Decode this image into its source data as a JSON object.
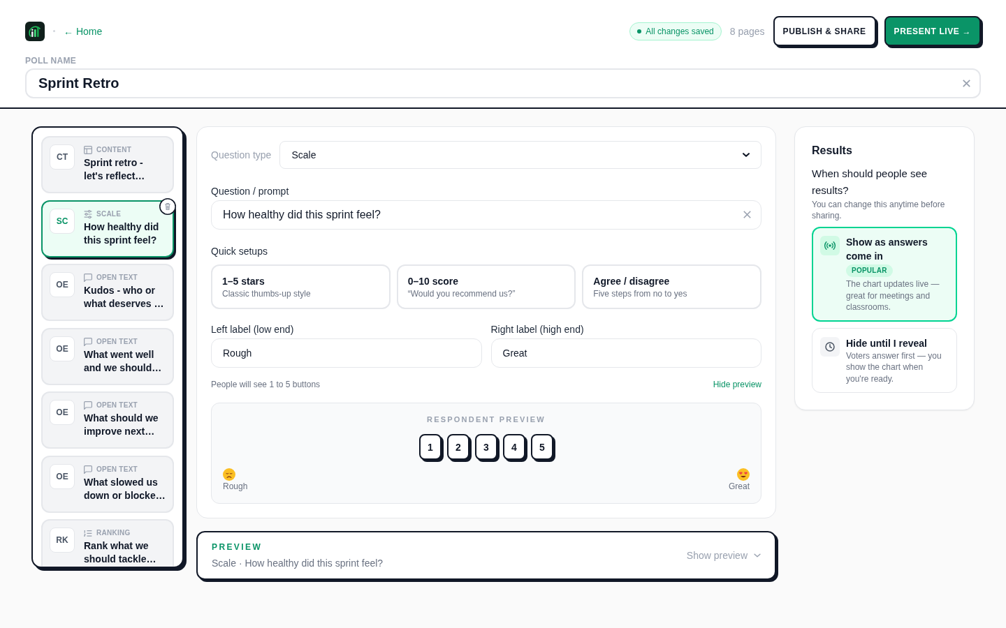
{
  "header": {
    "home_link": "← Home",
    "save_status": "All changes saved",
    "page_count": "8 pages",
    "actions": [
      {
        "label": "PUBLISH & SHARE",
        "kind": "secondary"
      },
      {
        "label": "PRESENT LIVE →",
        "kind": "primary"
      }
    ]
  },
  "poll_name": {
    "label": "POLL NAME",
    "value": "Sprint Retro"
  },
  "pages": [
    {
      "abbr": "CT",
      "kind": "content",
      "type_label": "CONTENT",
      "title": "Sprint retro - let's reflect…",
      "selected": false
    },
    {
      "abbr": "SC",
      "kind": "scale",
      "type_label": "SCALE",
      "title": "How healthy did this sprint feel?",
      "selected": true
    },
    {
      "abbr": "OE",
      "kind": "open_text",
      "type_label": "OPEN TEXT",
      "title": "Kudos - who or what deserves …",
      "selected": false
    },
    {
      "abbr": "OE",
      "kind": "open_text",
      "type_label": "OPEN TEXT",
      "title": "What went well and we should…",
      "selected": false
    },
    {
      "abbr": "OE",
      "kind": "open_text",
      "type_label": "OPEN TEXT",
      "title": "What should we improve next…",
      "selected": false
    },
    {
      "abbr": "OE",
      "kind": "open_text",
      "type_label": "OPEN TEXT",
      "title": "What slowed us down or blocke…",
      "selected": false
    },
    {
      "abbr": "RK",
      "kind": "ranking",
      "type_label": "RANKING",
      "title": "Rank what we should tackle…",
      "selected": false
    }
  ],
  "editor": {
    "question_type": {
      "label": "Question type",
      "value": "Scale"
    },
    "prompt": {
      "label": "Question / prompt",
      "value": "How healthy did this sprint feel?"
    },
    "quick_setups": {
      "label": "Quick setups",
      "options": [
        {
          "title": "1–5 stars",
          "subtitle": "Classic thumbs-up style"
        },
        {
          "title": "0–10 score",
          "subtitle": "“Would you recommend us?”"
        },
        {
          "title": "Agree / disagree",
          "subtitle": "Five steps from no to yes"
        }
      ]
    },
    "left_label": {
      "label": "Left label (low end)",
      "value": "Rough"
    },
    "right_label": {
      "label": "Right label (high end)",
      "value": "Great"
    },
    "hint": "People will see 1 to 5 buttons",
    "toggle_preview": "Hide preview",
    "respondent_preview": {
      "heading": "RESPONDENT PREVIEW",
      "buttons": [
        "1",
        "2",
        "3",
        "4",
        "5"
      ],
      "low_label": "Rough",
      "high_label": "Great"
    }
  },
  "preview_bar": {
    "heading": "PREVIEW",
    "summary": "Scale · How healthy did this sprint feel?",
    "toggle": "Show preview"
  },
  "results": {
    "title": "Results",
    "question": "When should people see results?",
    "hint": "You can change this anytime before sharing.",
    "options": [
      {
        "kind": "live",
        "title": "Show as answers come in",
        "badge": "POPULAR",
        "description": "The chart updates live — great for meetings and classrooms.",
        "selected": true
      },
      {
        "kind": "reveal",
        "title": "Hide until I reveal",
        "description": "Voters answer first — you show the chart when you're ready.",
        "selected": false
      }
    ]
  }
}
